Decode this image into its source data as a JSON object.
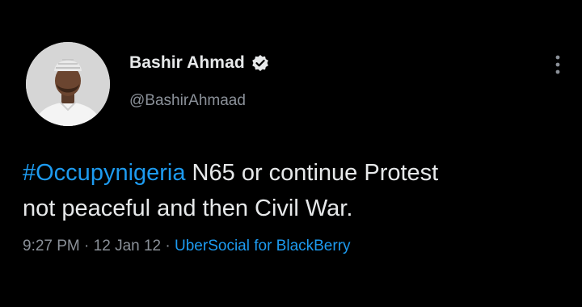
{
  "tweet": {
    "author": {
      "display_name": "Bashir Ahmad",
      "handle": "@BashirAhmaad",
      "verified": true
    },
    "text": {
      "hashtag": "#Occupynigeria",
      "body_line1": " N65 or continue Protest",
      "body_line2": "not peaceful and then Civil War."
    },
    "meta": {
      "time": "9:27 PM",
      "sep1": " · ",
      "date": "12 Jan 12",
      "sep2": " · ",
      "source": "UberSocial for BlackBerry"
    }
  },
  "colors": {
    "background": "#000000",
    "primary_text": "#e7e9ea",
    "secondary_text": "#8b9199",
    "link": "#1d9bf0"
  },
  "icons": {
    "verified": "verified-badge-icon",
    "more": "more-vertical-icon"
  }
}
